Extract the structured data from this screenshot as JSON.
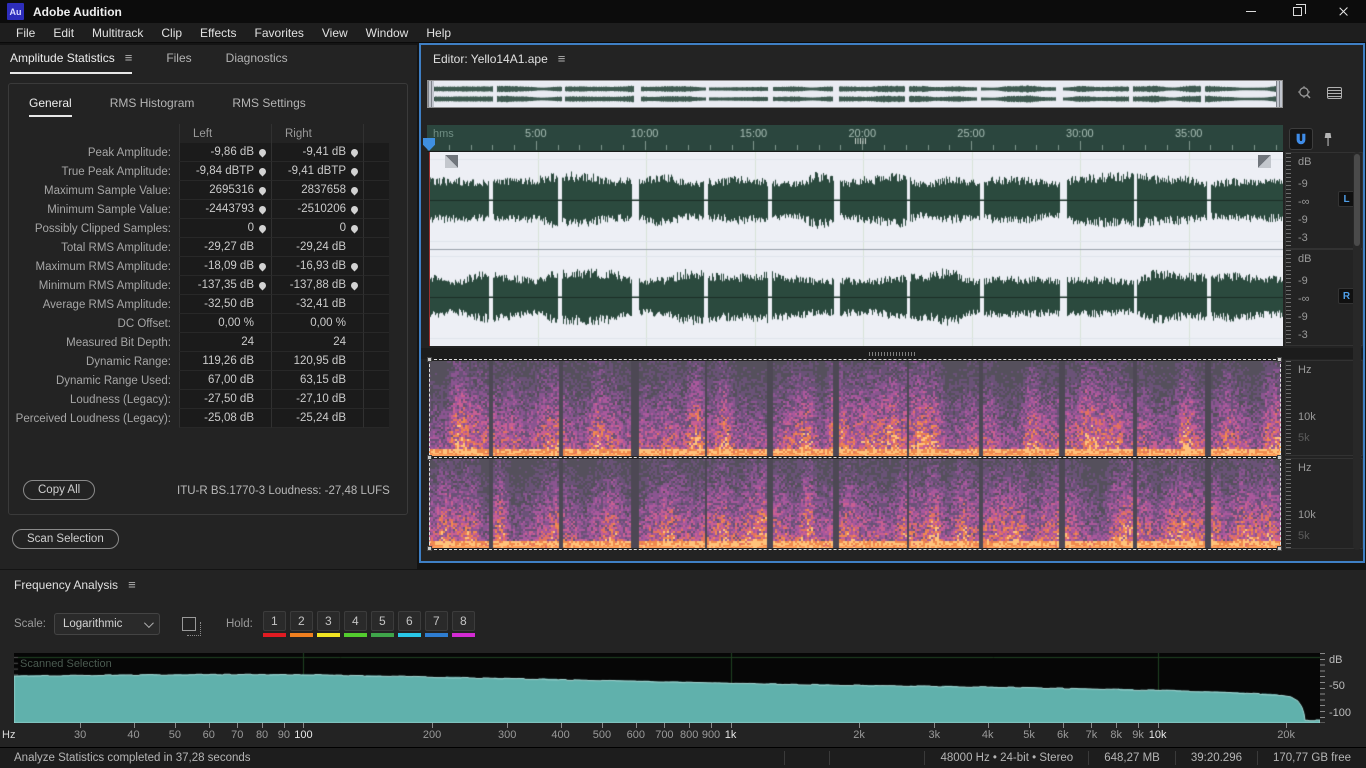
{
  "window": {
    "app_title": "Adobe Audition",
    "logo": "Au"
  },
  "menu": [
    "File",
    "Edit",
    "Multitrack",
    "Clip",
    "Effects",
    "Favorites",
    "View",
    "Window",
    "Help"
  ],
  "stats_panel": {
    "tabs": [
      {
        "label": "Amplitude Statistics",
        "active": true
      },
      {
        "label": "Files",
        "active": false
      },
      {
        "label": "Diagnostics",
        "active": false
      }
    ],
    "sub_tabs": [
      {
        "label": "General",
        "active": true
      },
      {
        "label": "RMS Histogram",
        "active": false
      },
      {
        "label": "RMS Settings",
        "active": false
      }
    ],
    "columns": [
      "Left",
      "Right"
    ],
    "rows": [
      {
        "label": "Peak Amplitude:",
        "left": "-9,86 dB",
        "right": "-9,41 dB",
        "pin": true
      },
      {
        "label": "True Peak Amplitude:",
        "left": "-9,84 dBTP",
        "right": "-9,41 dBTP",
        "pin": true
      },
      {
        "label": "Maximum Sample Value:",
        "left": "2695316",
        "right": "2837658",
        "pin": true
      },
      {
        "label": "Minimum Sample Value:",
        "left": "-2443793",
        "right": "-2510206",
        "pin": true
      },
      {
        "label": "Possibly Clipped Samples:",
        "left": "0",
        "right": "0",
        "pin": true
      },
      {
        "label": "Total RMS Amplitude:",
        "left": "-29,27 dB",
        "right": "-29,24 dB",
        "pin": false
      },
      {
        "label": "Maximum RMS Amplitude:",
        "left": "-18,09 dB",
        "right": "-16,93 dB",
        "pin": true
      },
      {
        "label": "Minimum RMS Amplitude:",
        "left": "-137,35 dB",
        "right": "-137,88 dB",
        "pin": true
      },
      {
        "label": "Average RMS Amplitude:",
        "left": "-32,50 dB",
        "right": "-32,41 dB",
        "pin": false
      },
      {
        "label": "DC Offset:",
        "left": "0,00 %",
        "right": "0,00 %",
        "pin": false
      },
      {
        "label": "Measured Bit Depth:",
        "left": "24",
        "right": "24",
        "pin": false
      },
      {
        "label": "Dynamic Range:",
        "left": "119,26 dB",
        "right": "120,95 dB",
        "pin": false
      },
      {
        "label": "Dynamic Range Used:",
        "left": "67,00 dB",
        "right": "63,15 dB",
        "pin": false
      },
      {
        "label": "Loudness (Legacy):",
        "left": "-27,50 dB",
        "right": "-27,10 dB",
        "pin": false
      },
      {
        "label": "Perceived Loudness (Legacy):",
        "left": "-25,08 dB",
        "right": "-25,24 dB",
        "pin": false
      }
    ],
    "copy_all_label": "Copy All",
    "loudness_info": "ITU-R BS.1770-3 Loudness:  -27,48 LUFS",
    "scan_selection_label": "Scan Selection"
  },
  "editor": {
    "title": "Editor: Yello14A1.ape",
    "ruler_unit": "hms",
    "ruler_ticks": [
      "5:00",
      "10:00",
      "15:00",
      "20:00",
      "25:00",
      "30:00",
      "35:00"
    ],
    "total_seconds": 2360,
    "db_scale": [
      "dB",
      "-9",
      "-∞",
      "-9",
      "-3"
    ],
    "channel_badges": [
      "L",
      "R"
    ],
    "hz_scale": [
      "Hz",
      "10k",
      "5k"
    ],
    "visual": {
      "wave_bg": "#edeff5",
      "wave_color": "#2b4a3e",
      "grid_color": "#d8e4d8",
      "ruler_bg": "#2b463e",
      "ruler_text": "#a9bfb6",
      "spec_bg": "#55505c",
      "spec_gap": "#4d4854",
      "spec_palette": [
        "#6a5277",
        "#8a5590",
        "#aa589c",
        "#c95f92",
        "#e27260",
        "#f08a4e",
        "#ffc27a"
      ],
      "spec_hotline": "#ff9e5a",
      "playhead_color": "#9e2f2f",
      "gaps": [
        {
          "p": 0.072,
          "w": 0.005
        },
        {
          "p": 0.153,
          "w": 0.004
        },
        {
          "p": 0.241,
          "w": 0.008
        },
        {
          "p": 0.324,
          "w": 0.004
        },
        {
          "p": 0.399,
          "w": 0.005
        },
        {
          "p": 0.477,
          "w": 0.007
        },
        {
          "p": 0.561,
          "w": 0.004
        },
        {
          "p": 0.647,
          "w": 0.005
        },
        {
          "p": 0.742,
          "w": 0.008
        },
        {
          "p": 0.827,
          "w": 0.004
        },
        {
          "p": 0.913,
          "w": 0.005
        }
      ]
    }
  },
  "freq_panel": {
    "title": "Frequency Analysis",
    "scale_label": "Scale:",
    "scale_value": "Logarithmic",
    "hold_label": "Hold:",
    "hold_buttons": [
      {
        "n": "1",
        "color": "#e11b22"
      },
      {
        "n": "2",
        "color": "#f07f1f"
      },
      {
        "n": "3",
        "color": "#f2e522"
      },
      {
        "n": "4",
        "color": "#53cc2e"
      },
      {
        "n": "5",
        "color": "#3fa54a"
      },
      {
        "n": "6",
        "color": "#29c8e8"
      },
      {
        "n": "7",
        "color": "#2e7dd1"
      },
      {
        "n": "8",
        "color": "#d42bd4"
      }
    ],
    "plot_label": "Scanned Selection",
    "y_ticks": [
      "dB",
      "-50",
      "-100"
    ],
    "x_axis_label": "Hz"
  },
  "chart_data": {
    "type": "area",
    "title": "Scanned Selection",
    "xlabel": "Hz",
    "ylabel": "dB",
    "x_scale": "log",
    "x_range": [
      21,
      24000
    ],
    "y_range": [
      -110,
      0
    ],
    "legend": "none",
    "grid_freqs": [
      100,
      1000,
      10000
    ],
    "colors": {
      "fill": "#62b3ae",
      "fill2": "#488f8d",
      "stroke": "#a5d9d5",
      "grid": "#1e4020",
      "bg": "#060606"
    },
    "x_ticks": [
      {
        "f": 30,
        "label": "30"
      },
      {
        "f": 40,
        "label": "40"
      },
      {
        "f": 50,
        "label": "50"
      },
      {
        "f": 60,
        "label": "60"
      },
      {
        "f": 70,
        "label": "70"
      },
      {
        "f": 80,
        "label": "80"
      },
      {
        "f": 90,
        "label": "90"
      },
      {
        "f": 100,
        "label": "100",
        "bright": true
      },
      {
        "f": 200,
        "label": "200"
      },
      {
        "f": 300,
        "label": "300"
      },
      {
        "f": 400,
        "label": "400"
      },
      {
        "f": 500,
        "label": "500"
      },
      {
        "f": 600,
        "label": "600"
      },
      {
        "f": 700,
        "label": "700"
      },
      {
        "f": 800,
        "label": "800"
      },
      {
        "f": 900,
        "label": "900"
      },
      {
        "f": 1000,
        "label": "1k",
        "bright": true
      },
      {
        "f": 2000,
        "label": "2k"
      },
      {
        "f": 3000,
        "label": "3k"
      },
      {
        "f": 4000,
        "label": "4k"
      },
      {
        "f": 5000,
        "label": "5k"
      },
      {
        "f": 6000,
        "label": "6k"
      },
      {
        "f": 7000,
        "label": "7k"
      },
      {
        "f": 8000,
        "label": "8k"
      },
      {
        "f": 9000,
        "label": "9k"
      },
      {
        "f": 10000,
        "label": "10k",
        "bright": true
      },
      {
        "f": 20000,
        "label": "20k"
      }
    ],
    "points": [
      [
        21,
        -33
      ],
      [
        25,
        -32.5
      ],
      [
        32,
        -32
      ],
      [
        40,
        -31.5
      ],
      [
        50,
        -31
      ],
      [
        63,
        -30.5
      ],
      [
        80,
        -30.5
      ],
      [
        100,
        -31
      ],
      [
        125,
        -32
      ],
      [
        160,
        -33.5
      ],
      [
        200,
        -35
      ],
      [
        250,
        -36.5
      ],
      [
        315,
        -38
      ],
      [
        400,
        -39.5
      ],
      [
        500,
        -41
      ],
      [
        630,
        -42.5
      ],
      [
        800,
        -44
      ],
      [
        1000,
        -45.5
      ],
      [
        1250,
        -47
      ],
      [
        1600,
        -48.5
      ],
      [
        2000,
        -49.5
      ],
      [
        2500,
        -50.5
      ],
      [
        3150,
        -51.5
      ],
      [
        4000,
        -52.5
      ],
      [
        5000,
        -53.5
      ],
      [
        6300,
        -55
      ],
      [
        8000,
        -56.5
      ],
      [
        10000,
        -58
      ],
      [
        12500,
        -60
      ],
      [
        16000,
        -63
      ],
      [
        19000,
        -66
      ],
      [
        20500,
        -70
      ],
      [
        21300,
        -77
      ],
      [
        21800,
        -88
      ],
      [
        22050,
        -100
      ],
      [
        22100,
        -110
      ]
    ]
  },
  "status_bar": {
    "message": "Analyze Statistics completed in 37,28 seconds",
    "format": "48000 Hz • 24-bit • Stereo",
    "file_size": "648,27 MB",
    "duration": "39:20.296",
    "free_space": "170,77 GB free"
  }
}
